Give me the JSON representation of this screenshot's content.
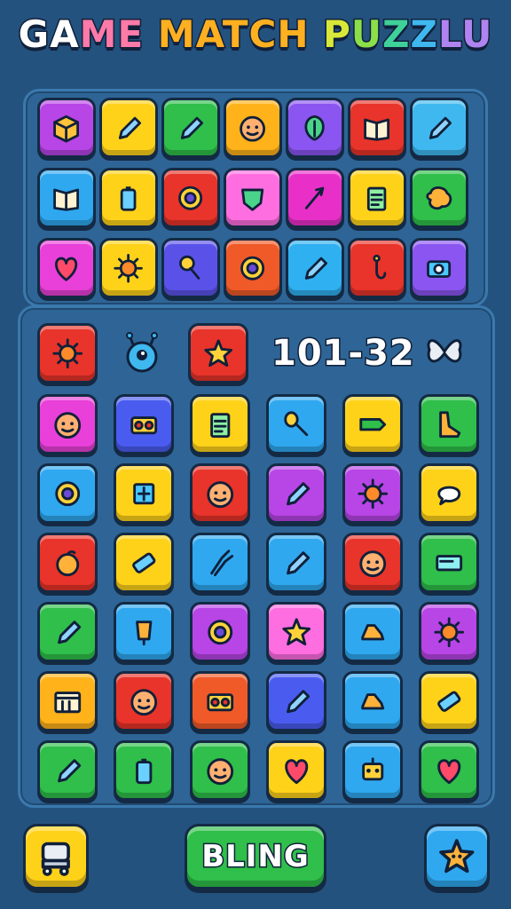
{
  "title": {
    "letters": [
      {
        "ch": "G",
        "color": "#ffffff"
      },
      {
        "ch": "A",
        "color": "#ffffff"
      },
      {
        "ch": "M",
        "color": "#ff7aa8"
      },
      {
        "ch": "E",
        "color": "#ff7aa8"
      },
      {
        "ch": " ",
        "color": "#ffffff"
      },
      {
        "ch": "M",
        "color": "#ffb020"
      },
      {
        "ch": "A",
        "color": "#ffb020"
      },
      {
        "ch": "T",
        "color": "#ffb020"
      },
      {
        "ch": "C",
        "color": "#ffb020"
      },
      {
        "ch": "H",
        "color": "#ffb020"
      },
      {
        "ch": " ",
        "color": "#ffffff"
      },
      {
        "ch": "P",
        "color": "#d8e838"
      },
      {
        "ch": "U",
        "color": "#8be04a"
      },
      {
        "ch": "Z",
        "color": "#3ed19a"
      },
      {
        "ch": "Z",
        "color": "#3fb8f0"
      },
      {
        "ch": "L",
        "color": "#b084f0"
      },
      {
        "ch": "U",
        "color": "#b084f0"
      }
    ]
  },
  "score": "101-32",
  "action_button_label": "BLING",
  "icons": {
    "settings_badge": "butterfly-icon",
    "robot": "robot-icon",
    "star_button": "star-face-icon"
  },
  "top_grid": [
    [
      {
        "color": "#b845e6",
        "icon": "cube"
      },
      {
        "color": "#ffd21a",
        "icon": "pencil"
      },
      {
        "color": "#2fbf4a",
        "icon": "pencil"
      },
      {
        "color": "#ffb21a",
        "icon": "face"
      },
      {
        "color": "#8a55f0",
        "icon": "leaf"
      },
      {
        "color": "#e8342a",
        "icon": "book"
      },
      {
        "color": "#3fb8f0",
        "icon": "pencil"
      }
    ],
    [
      {
        "color": "#2fa8f0",
        "icon": "book"
      },
      {
        "color": "#ffd21a",
        "icon": "battery"
      },
      {
        "color": "#e8342a",
        "icon": "ring"
      },
      {
        "color": "#ff6ee0",
        "icon": "shield"
      },
      {
        "color": "#e830c8",
        "icon": "arrow"
      },
      {
        "color": "#ffd21a",
        "icon": "note"
      },
      {
        "color": "#2fbf4a",
        "icon": "blob"
      }
    ],
    [
      {
        "color": "#e840d8",
        "icon": "heart"
      },
      {
        "color": "#ffd21a",
        "icon": "sun"
      },
      {
        "color": "#5a52e8",
        "icon": "key"
      },
      {
        "color": "#f05a28",
        "icon": "ring"
      },
      {
        "color": "#2fb0f0",
        "icon": "pencil"
      },
      {
        "color": "#e8342a",
        "icon": "hook"
      },
      {
        "color": "#8a55f0",
        "icon": "camera"
      }
    ]
  ],
  "bottom_row0": [
    {
      "color": "#e8342a",
      "icon": "sun",
      "slot": 0
    },
    {
      "color": "#e8342a",
      "icon": "star",
      "slot": 2
    }
  ],
  "bottom_grid": [
    [
      {
        "color": "#e840d8",
        "icon": "face"
      },
      {
        "color": "#4a5cf0",
        "icon": "radio"
      },
      {
        "color": "#ffd21a",
        "icon": "note"
      },
      {
        "color": "#2fa8f0",
        "icon": "spoon"
      },
      {
        "color": "#ffd21a",
        "icon": "tag"
      },
      {
        "color": "#2fbf4a",
        "icon": "boot"
      }
    ],
    [
      {
        "color": "#2fa8f0",
        "icon": "ring"
      },
      {
        "color": "#ffd21a",
        "icon": "square"
      },
      {
        "color": "#e8342a",
        "icon": "face"
      },
      {
        "color": "#b845e6",
        "icon": "pencil"
      },
      {
        "color": "#b845e6",
        "icon": "sun"
      },
      {
        "color": "#ffd21a",
        "icon": "bubble"
      }
    ],
    [
      {
        "color": "#e8342a",
        "icon": "fruit"
      },
      {
        "color": "#ffd21a",
        "icon": "bandage"
      },
      {
        "color": "#2fa8f0",
        "icon": "tongs"
      },
      {
        "color": "#2fa8f0",
        "icon": "pencil"
      },
      {
        "color": "#e8342a",
        "icon": "face"
      },
      {
        "color": "#2fbf4a",
        "icon": "card"
      }
    ],
    [
      {
        "color": "#2fbf4a",
        "icon": "pencil"
      },
      {
        "color": "#2fa8f0",
        "icon": "cup"
      },
      {
        "color": "#b845e6",
        "icon": "ring"
      },
      {
        "color": "#ff6ee0",
        "icon": "star"
      },
      {
        "color": "#2fa8f0",
        "icon": "shoe"
      },
      {
        "color": "#b845e6",
        "icon": "sun"
      }
    ],
    [
      {
        "color": "#ffb21a",
        "icon": "box"
      },
      {
        "color": "#e8342a",
        "icon": "face"
      },
      {
        "color": "#f05a28",
        "icon": "radio"
      },
      {
        "color": "#4a5cf0",
        "icon": "pencil"
      },
      {
        "color": "#2fa8f0",
        "icon": "shoe"
      },
      {
        "color": "#ffd21a",
        "icon": "bandage"
      }
    ],
    [
      {
        "color": "#2fbf4a",
        "icon": "pencil"
      },
      {
        "color": "#2fbf4a",
        "icon": "battery"
      },
      {
        "color": "#2fbf4a",
        "icon": "face"
      },
      {
        "color": "#ffd21a",
        "icon": "heart"
      },
      {
        "color": "#2fa8f0",
        "icon": "robot"
      },
      {
        "color": "#2fbf4a",
        "icon": "heart"
      }
    ]
  ],
  "buttons": {
    "left": {
      "color": "#ffd21a",
      "icon": "cart"
    },
    "center": {
      "color": "#2fbf4a"
    },
    "right": {
      "color": "#2fa8f0",
      "icon": "star-face"
    }
  }
}
